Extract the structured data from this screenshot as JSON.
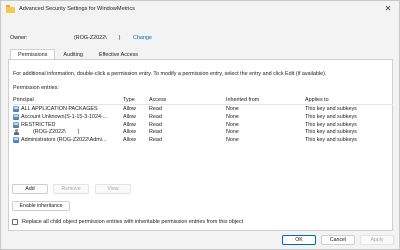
{
  "window": {
    "title": "Advanced Security Settings for WindowMetrics",
    "close_glyph": "✕"
  },
  "owner": {
    "label": "Owner:",
    "value": "(ROG-Z2022\\        )",
    "change_link": "Change"
  },
  "tabs": [
    {
      "label": "Permissions",
      "active": true
    },
    {
      "label": "Auditing",
      "active": false
    },
    {
      "label": "Effective Access",
      "active": false
    }
  ],
  "info_text": "For additional information, double-click a permission entry. To modify a permission entry, select the entry and click Edit (if available).",
  "entries_label": "Permission entries:",
  "columns": {
    "principal": "Principal",
    "type": "Type",
    "access": "Access",
    "inherited_from": "Inherited from",
    "applies_to": "Applies to"
  },
  "entries": [
    {
      "icon": "group-icon",
      "principal": "ALL APPLICATION PACKAGES",
      "type": "Allow",
      "access": "Read",
      "inherited_from": "None",
      "applies_to": "This key and subkeys"
    },
    {
      "icon": "group-icon",
      "principal": "Account Unknown(S-1-15-3-1024-...",
      "type": "Allow",
      "access": "Read",
      "inherited_from": "None",
      "applies_to": "This key and subkeys"
    },
    {
      "icon": "group-icon",
      "principal": "RESTRICTED",
      "type": "Allow",
      "access": "Read",
      "inherited_from": "None",
      "applies_to": "This key and subkeys"
    },
    {
      "icon": "user-icon",
      "principal": "        (ROG-Z2022\\        )",
      "type": "Allow",
      "access": "Read",
      "inherited_from": "None",
      "applies_to": "This key and subkeys"
    },
    {
      "icon": "group-icon",
      "principal": "Administrators (ROG-Z2022\\Admi...",
      "type": "Allow",
      "access": "Read",
      "inherited_from": "None",
      "applies_to": "This key and subkeys"
    }
  ],
  "buttons": {
    "add": "Add",
    "remove": "Remove",
    "view": "View",
    "enable_inheritance": "Enable inheritance",
    "ok": "OK",
    "cancel": "Cancel",
    "apply": "Apply"
  },
  "replace_checkbox": {
    "label": "Replace all child object permission entries with inheritable permission entries from this object",
    "checked": false
  },
  "colors": {
    "link": "#0067c0",
    "primary_border": "#0067c0",
    "folder": "#f6c84c"
  }
}
